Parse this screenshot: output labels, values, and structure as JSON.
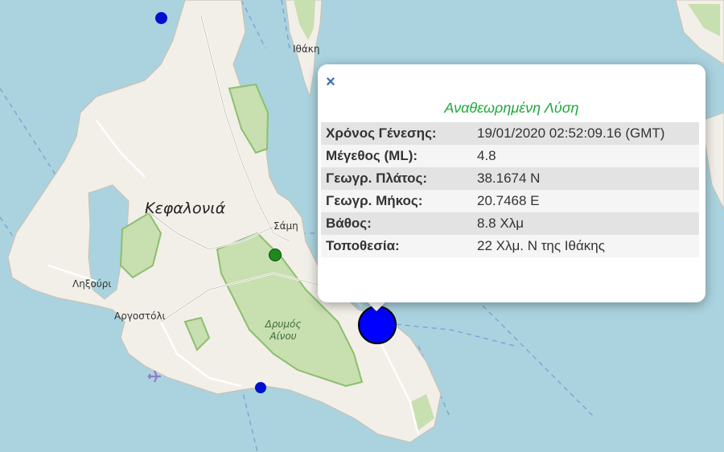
{
  "map": {
    "labels": {
      "island": "Κεφαλονιά",
      "ithaca": "Ιθάκη",
      "sami": "Σάμη",
      "lixouri": "Ληξούρι",
      "argostoli": "Αργοστόλι",
      "park": "Δρυμός Αίνου"
    },
    "colors": {
      "sea": "#aad3df",
      "land": "#f2efe9",
      "forest": "#c8dfb0",
      "quake_marker": "#0000ff",
      "small_marker": "#0010cc",
      "green_marker": "#1e8a1e"
    }
  },
  "popup": {
    "close_symbol": "×",
    "title": "Αναθεωρημένη Λύση",
    "rows": [
      {
        "key": "Χρόνος Γένεσης:",
        "value": "19/01/2020 02:52:09.16 (GMT)"
      },
      {
        "key": "Μέγεθος (ML):",
        "value": "4.8"
      },
      {
        "key": "Γεωγρ. Πλάτος:",
        "value": "38.1674 N"
      },
      {
        "key": "Γεωγρ. Μήκος:",
        "value": "20.7468 E"
      },
      {
        "key": "Βάθος:",
        "value": "8.8 Χλμ"
      },
      {
        "key": "Τοποθεσία:",
        "value": "22 Χλμ. Ν της Ιθάκης"
      }
    ]
  }
}
